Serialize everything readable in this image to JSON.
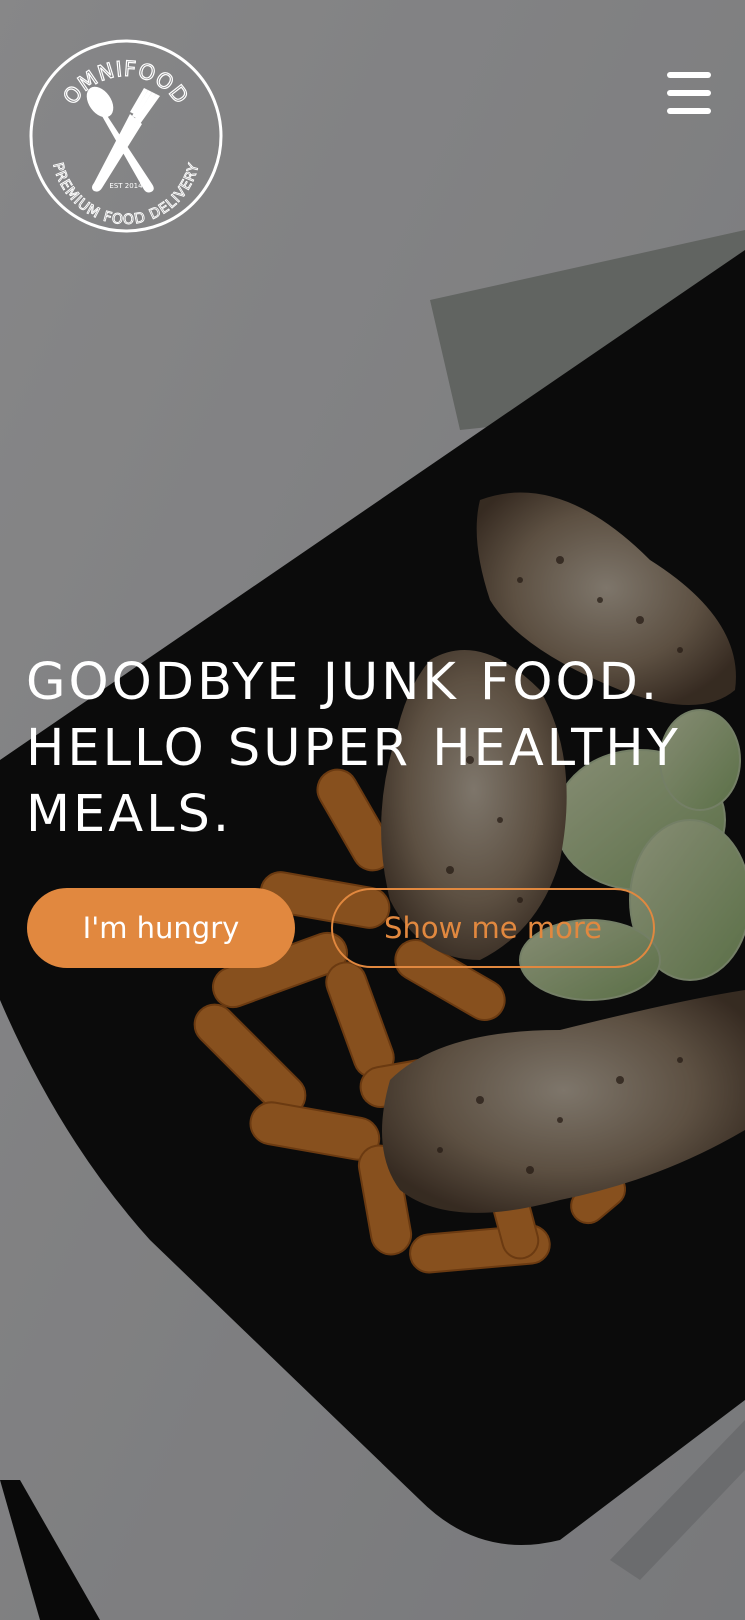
{
  "header": {
    "logo": {
      "icon": "omnifood-logo",
      "brand": "OMNIFOOD",
      "established": "EST 2014",
      "tagline": "PREMIUM FOOD DELIVERY"
    },
    "menu_icon": "hamburger-menu-icon"
  },
  "hero": {
    "headline_lines": [
      "GOODBYE JUNK FOOD.",
      "HELLO SUPER HEALTHY",
      "MEALS."
    ],
    "primary_button_label": "I'm hungry",
    "secondary_button_label": "Show me more"
  },
  "colors": {
    "accent": "#e1883f",
    "text": "#ffffff",
    "overlay": "#000000"
  }
}
